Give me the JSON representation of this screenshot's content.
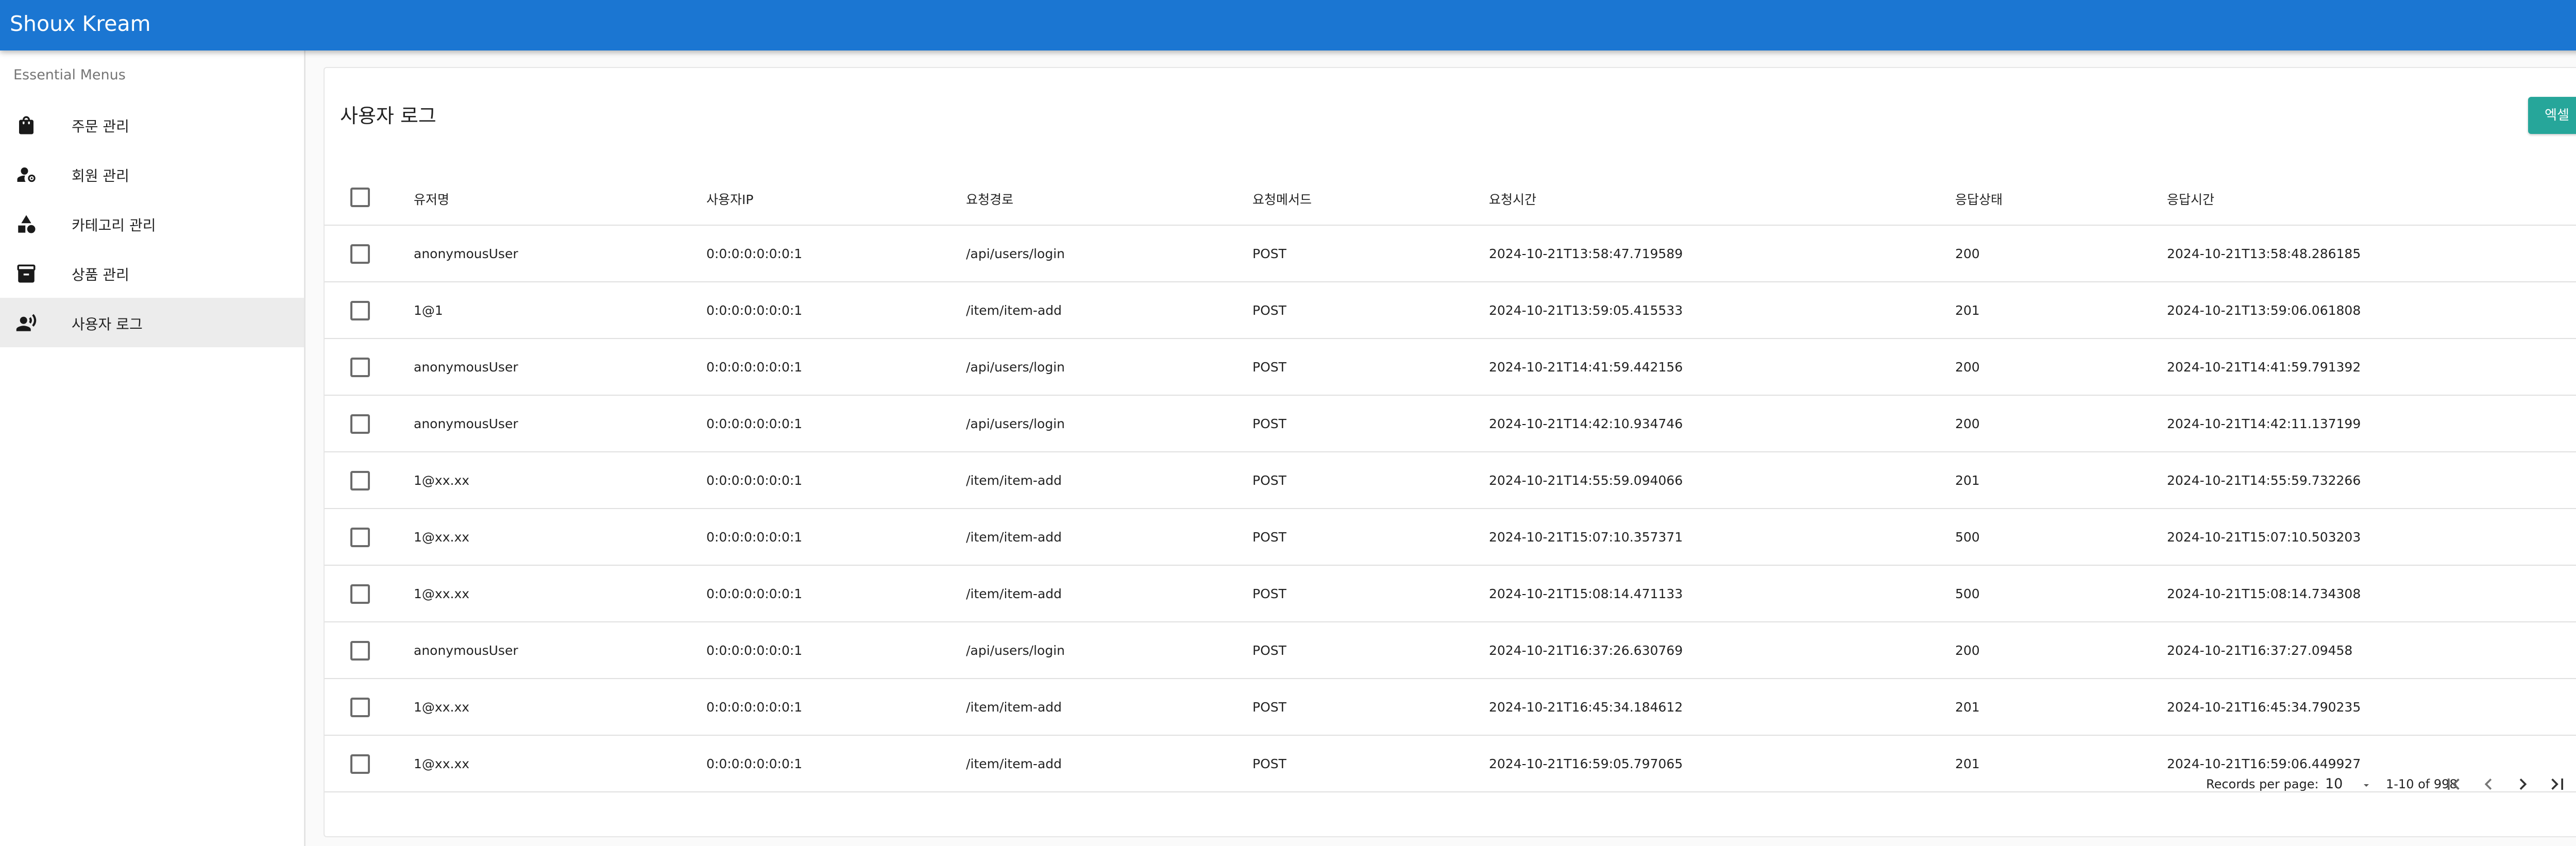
{
  "app": {
    "title": "Shoux Kream"
  },
  "sidebar": {
    "subheader": "Essential Menus",
    "items": [
      {
        "label": "주문 관리",
        "icon": "shopping-bag-icon"
      },
      {
        "label": "회원 관리",
        "icon": "manage-accounts-icon"
      },
      {
        "label": "카테고리 관리",
        "icon": "category-icon"
      },
      {
        "label": "상품 관리",
        "icon": "inventory-icon"
      },
      {
        "label": "사용자 로그",
        "icon": "record-voice-icon",
        "active": true
      }
    ]
  },
  "page": {
    "title": "사용자 로그",
    "excel_button": "엑셀"
  },
  "table": {
    "columns": [
      "유저명",
      "사용자IP",
      "요청경로",
      "요청메서드",
      "요청시간",
      "응답상태",
      "응답시간"
    ],
    "rows": [
      [
        "anonymousUser",
        "0:0:0:0:0:0:0:1",
        "/api/users/login",
        "POST",
        "2024-10-21T13:58:47.719589",
        "200",
        "2024-10-21T13:58:48.286185"
      ],
      [
        "1@1",
        "0:0:0:0:0:0:0:1",
        "/item/item-add",
        "POST",
        "2024-10-21T13:59:05.415533",
        "201",
        "2024-10-21T13:59:06.061808"
      ],
      [
        "anonymousUser",
        "0:0:0:0:0:0:0:1",
        "/api/users/login",
        "POST",
        "2024-10-21T14:41:59.442156",
        "200",
        "2024-10-21T14:41:59.791392"
      ],
      [
        "anonymousUser",
        "0:0:0:0:0:0:0:1",
        "/api/users/login",
        "POST",
        "2024-10-21T14:42:10.934746",
        "200",
        "2024-10-21T14:42:11.137199"
      ],
      [
        "1@xx.xx",
        "0:0:0:0:0:0:0:1",
        "/item/item-add",
        "POST",
        "2024-10-21T14:55:59.094066",
        "201",
        "2024-10-21T14:55:59.732266"
      ],
      [
        "1@xx.xx",
        "0:0:0:0:0:0:0:1",
        "/item/item-add",
        "POST",
        "2024-10-21T15:07:10.357371",
        "500",
        "2024-10-21T15:07:10.503203"
      ],
      [
        "1@xx.xx",
        "0:0:0:0:0:0:0:1",
        "/item/item-add",
        "POST",
        "2024-10-21T15:08:14.471133",
        "500",
        "2024-10-21T15:08:14.734308"
      ],
      [
        "anonymousUser",
        "0:0:0:0:0:0:0:1",
        "/api/users/login",
        "POST",
        "2024-10-21T16:37:26.630769",
        "200",
        "2024-10-21T16:37:27.09458"
      ],
      [
        "1@xx.xx",
        "0:0:0:0:0:0:0:1",
        "/item/item-add",
        "POST",
        "2024-10-21T16:45:34.184612",
        "201",
        "2024-10-21T16:45:34.790235"
      ],
      [
        "1@xx.xx",
        "0:0:0:0:0:0:0:1",
        "/item/item-add",
        "POST",
        "2024-10-21T16:59:05.797065",
        "201",
        "2024-10-21T16:59:06.449927"
      ]
    ]
  },
  "pagination": {
    "records_per_page_label": "Records per page:",
    "records_per_page": "10",
    "range": "1-10 of 998"
  },
  "colors": {
    "appbar": "#1b76d2",
    "excel_button": "#26a69a",
    "active_nav": "#ececec"
  }
}
